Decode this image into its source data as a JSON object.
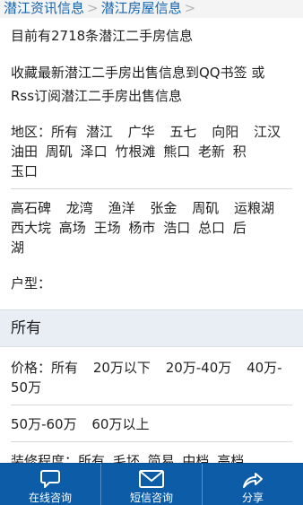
{
  "breadcrumb": {
    "items": [
      "潜江资讯信息",
      "潜江房屋信息"
    ],
    "separator": ">"
  },
  "listing": {
    "count_text": "目前有2718条潜江二手房信息",
    "subscribe_line1": "收藏最新潜江二手房出售信息到QQ书签 或",
    "subscribe_line2": "Rss订阅潜江二手房出售信息"
  },
  "filters": {
    "area_label": "地区：",
    "area_row1": [
      "所有",
      "潜江",
      "广华",
      "五七",
      "向阳",
      "江汉"
    ],
    "area_row2": [
      "油田",
      "周矶",
      "泽口",
      "竹根滩",
      "熊口",
      "老新",
      "积"
    ],
    "area_row3": [
      "玉口"
    ],
    "area_row4": [
      "高石碑",
      "龙湾",
      "渔洋",
      "张金",
      "周矶",
      "运粮湖"
    ],
    "area_row5": [
      "西大垸",
      "高场",
      "王场",
      "杨市",
      "浩口",
      "总口",
      "后"
    ],
    "area_row6": [
      "湖"
    ],
    "type_label": "户型：",
    "section_title": "所有",
    "price_label": "价格：",
    "price_row1": [
      "所有",
      "20万以下",
      "20万-40万",
      "40万-"
    ],
    "price_row2": [
      "50万"
    ],
    "price_row3": [
      "50万-60万",
      "60万以上"
    ],
    "decor_label": "装修程度：",
    "decor_options": [
      "所有",
      "毛坯",
      "简易",
      "中档",
      "高档"
    ]
  },
  "bottom_bar": {
    "tabs": [
      {
        "label": "在线咨询",
        "icon": "chat-icon"
      },
      {
        "label": "短信咨询",
        "icon": "envelope-icon"
      },
      {
        "label": "分享",
        "icon": "share-icon"
      }
    ],
    "bg_color": "#0d5ca8"
  },
  "colors": {
    "link": "#1565b0",
    "section_bg": "#e9eef5"
  }
}
